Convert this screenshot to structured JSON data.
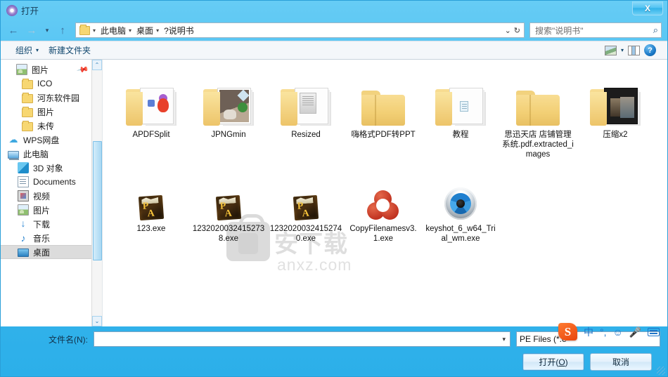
{
  "window": {
    "title": "打开",
    "icon": "app-circle-icon",
    "close_label": "X"
  },
  "nav": {
    "back_icon": "←",
    "forward_icon": "→",
    "recent_icon": "▾",
    "up_icon": "↑",
    "breadcrumb": [
      {
        "label": "此电脑"
      },
      {
        "label": "桌面"
      },
      {
        "label": "?说明书"
      }
    ],
    "history_icon": "⌄",
    "refresh_icon": "↻",
    "search_placeholder": "搜索\"说明书\"",
    "search_icon": "⌕"
  },
  "commandbar": {
    "organize_label": "组织",
    "newfolder_label": "新建文件夹",
    "caret": "▾",
    "view_icon": "view-icon",
    "preview_icon": "preview-pane-icon",
    "help_label": "?"
  },
  "sidebar": {
    "items": [
      {
        "label": "图片",
        "icon": "picture-icon",
        "indent": 22,
        "pinned": true,
        "selected": false
      },
      {
        "label": "ICO",
        "icon": "folder-icon",
        "indent": 30,
        "pinned": false,
        "selected": false
      },
      {
        "label": "河东软件园",
        "icon": "folder-icon",
        "indent": 30,
        "pinned": false,
        "selected": false
      },
      {
        "label": "图片",
        "icon": "folder-icon",
        "indent": 30,
        "pinned": false,
        "selected": false
      },
      {
        "label": "未传",
        "icon": "folder-icon",
        "indent": 30,
        "pinned": false,
        "selected": false
      },
      {
        "label": "WPS网盘",
        "icon": "cloud-icon",
        "indent": 10,
        "pinned": false,
        "selected": false
      },
      {
        "label": "此电脑",
        "icon": "computer-icon",
        "indent": 10,
        "pinned": false,
        "selected": false
      },
      {
        "label": "3D 对象",
        "icon": "3d-objects-icon",
        "indent": 24,
        "pinned": false,
        "selected": false
      },
      {
        "label": "Documents",
        "icon": "documents-icon",
        "indent": 24,
        "pinned": false,
        "selected": false
      },
      {
        "label": "视频",
        "icon": "videos-icon",
        "indent": 24,
        "pinned": false,
        "selected": false
      },
      {
        "label": "图片",
        "icon": "picture-icon",
        "indent": 24,
        "pinned": false,
        "selected": false
      },
      {
        "label": "下载",
        "icon": "downloads-icon",
        "indent": 24,
        "pinned": false,
        "selected": false
      },
      {
        "label": "音乐",
        "icon": "music-icon",
        "indent": 24,
        "pinned": false,
        "selected": false
      },
      {
        "label": "桌面",
        "icon": "desktop-icon",
        "indent": 24,
        "pinned": false,
        "selected": true
      }
    ],
    "scroll_up_icon": "⌃",
    "scroll_down_icon": "⌄"
  },
  "files": {
    "row1": [
      {
        "name": "APDFSplit",
        "kind": "folder-open-preview"
      },
      {
        "name": "JPNGmin",
        "kind": "folder-open-photo"
      },
      {
        "name": "Resized",
        "kind": "folder-open-docs"
      },
      {
        "name": "嗨格式PDF转PPT",
        "kind": "folder-closed"
      },
      {
        "name": "教程",
        "kind": "folder-open-doc"
      },
      {
        "name": "思迅天店 店铺管理系统.pdf.extracted_images",
        "kind": "folder-closed"
      },
      {
        "name": "压缩x2",
        "kind": "folder-open-dark"
      }
    ],
    "row2": [
      {
        "name": "123.exe",
        "kind": "pa-exe"
      },
      {
        "name": "12320200324152738.exe",
        "kind": "pa-exe"
      },
      {
        "name": "12320200324152740.exe",
        "kind": "pa-exe"
      },
      {
        "name": "CopyFilenamesv3.1.exe",
        "kind": "trefoil-exe"
      },
      {
        "name": "keyshot_6_w64_Trial_wm.exe",
        "kind": "aperture-exe"
      }
    ]
  },
  "watermark": {
    "text": "安下载",
    "sub": "anxz.com"
  },
  "bottom": {
    "filename_label": "文件名(N):",
    "filename_value": "",
    "filetype_value": "PE Files (*.e",
    "open_label": "打开(",
    "open_accel": "O",
    "open_suffix": ")",
    "cancel_label": "取消"
  },
  "ime": {
    "logo": "S",
    "mode": "中",
    "punct": "°,",
    "emoji": "☺",
    "mic": "🎤",
    "keyboard": "keyboard-icon"
  },
  "colors": {
    "title_gradient_start": "#66ccf5",
    "accent": "#2a7bb5",
    "folder": "#f2cf74",
    "selection": "#dcdcdc"
  }
}
